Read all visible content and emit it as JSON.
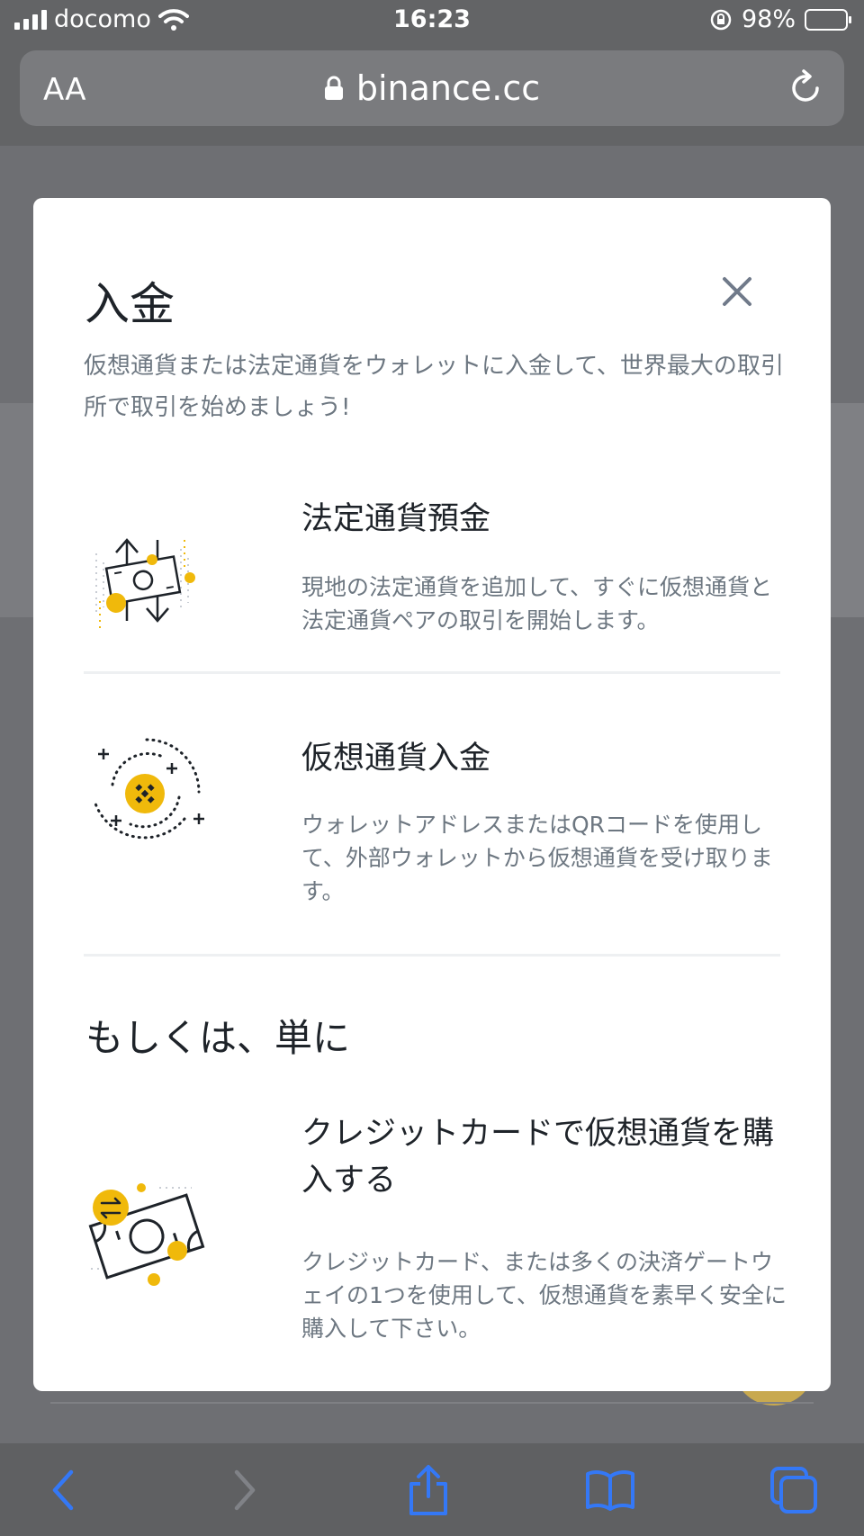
{
  "status_bar": {
    "carrier": "docomo",
    "time": "16:23",
    "battery": "98%",
    "battery_level": 0.98
  },
  "browser": {
    "text_size_label": "AA",
    "url": "binance.cc",
    "lock_icon": "lock-icon",
    "reload_icon": "reload-icon"
  },
  "modal": {
    "title": "入金",
    "description": "仮想通貨または法定通貨をウォレットに入金して、世界最大の取引所で取引を始めましょう!",
    "options": [
      {
        "icon": "fiat-exchange-illustration",
        "title": "法定通貨預金",
        "description": "現地の法定通貨を追加して、すぐに仮想通貨と法定通貨ペアの取引を開始します。"
      },
      {
        "icon": "crypto-deposit-illustration",
        "title": "仮想通貨入金",
        "description": "ウォレットアドレスまたはQRコードを使用して、外部ウォレットから仮想通貨を受け取ります。"
      }
    ],
    "alt_section_title": "もしくは、単に",
    "alt_option": {
      "icon": "credit-card-illustration",
      "title": "クレジットカードで仮想通貨を購入する",
      "description": "クレジットカード、または多くの決済ゲートウェイの1つを使用して、仮想通貨を素早く安全に購入して下さい。"
    }
  },
  "colors": {
    "brand_yellow": "#f0b90b",
    "text_primary": "#1e2329",
    "text_secondary": "#6d7781",
    "ios_blue": "#3478f6"
  }
}
